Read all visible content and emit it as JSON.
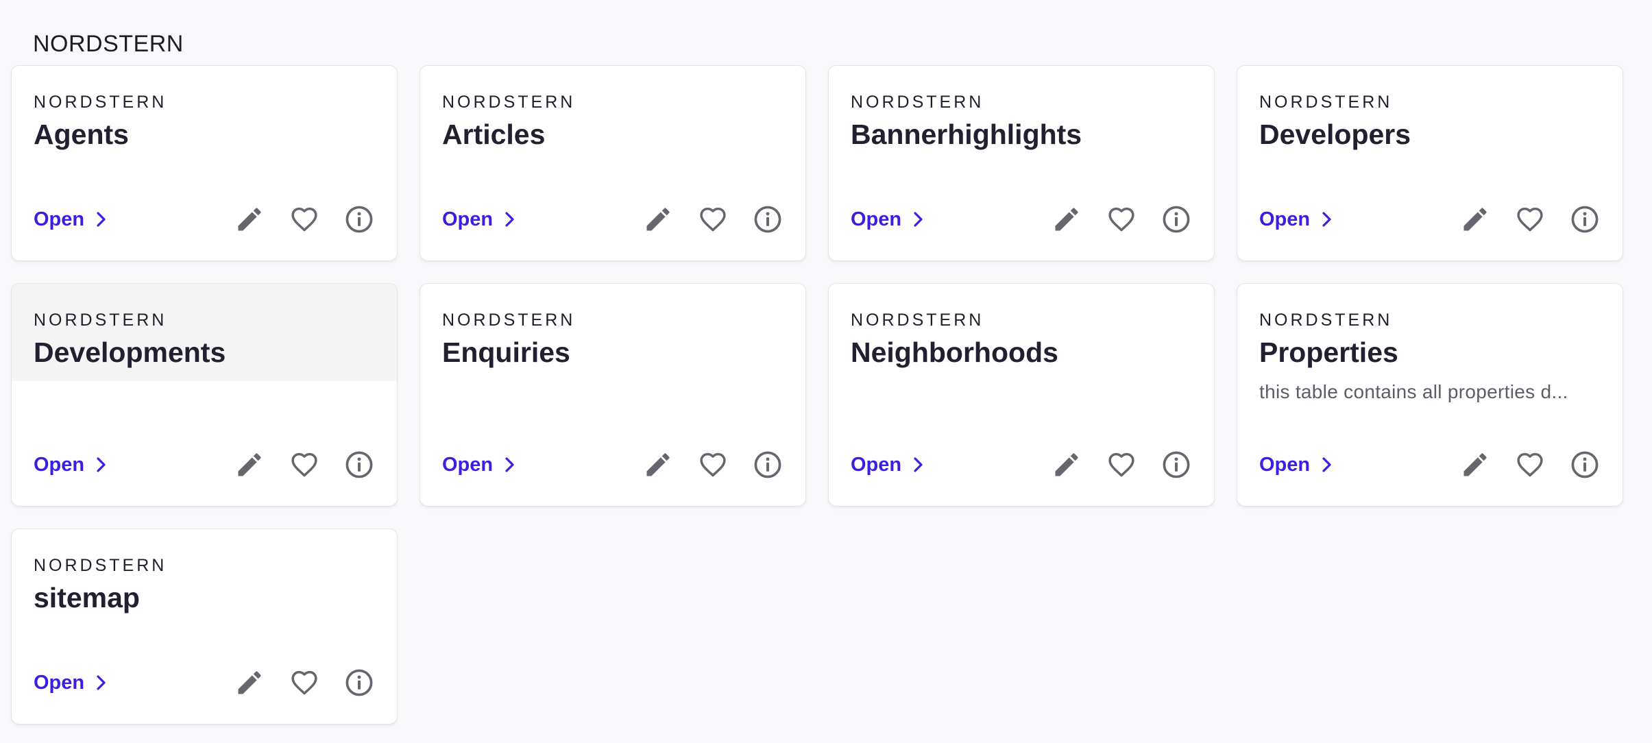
{
  "header": {
    "title": "NORDSTERN"
  },
  "cards": [
    {
      "overline": "NORDSTERN",
      "title": "Agents",
      "description": "",
      "open_label": "Open",
      "icons": [
        "pencil-icon",
        "heart-icon",
        "info-icon"
      ]
    },
    {
      "overline": "NORDSTERN",
      "title": "Articles",
      "description": "",
      "open_label": "Open",
      "icons": [
        "pencil-icon",
        "heart-icon",
        "info-icon"
      ]
    },
    {
      "overline": "NORDSTERN",
      "title": "Bannerhighlights",
      "description": "",
      "open_label": "Open",
      "icons": [
        "pencil-icon",
        "heart-icon",
        "info-icon"
      ]
    },
    {
      "overline": "NORDSTERN",
      "title": "Developers",
      "description": "",
      "open_label": "Open",
      "icons": [
        "pencil-icon",
        "heart-icon",
        "info-icon"
      ]
    },
    {
      "overline": "NORDSTERN",
      "title": "Developments",
      "description": "",
      "open_label": "Open",
      "icons": [
        "pencil-icon",
        "heart-icon",
        "info-icon"
      ]
    },
    {
      "overline": "NORDSTERN",
      "title": "Enquiries",
      "description": "",
      "open_label": "Open",
      "icons": [
        "pencil-icon",
        "heart-icon",
        "info-icon"
      ]
    },
    {
      "overline": "NORDSTERN",
      "title": "Neighborhoods",
      "description": "",
      "open_label": "Open",
      "icons": [
        "pencil-icon",
        "heart-icon",
        "info-icon"
      ]
    },
    {
      "overline": "NORDSTERN",
      "title": "Properties",
      "description": "this table contains all properties d...",
      "open_label": "Open",
      "icons": [
        "pencil-icon",
        "heart-icon",
        "info-icon"
      ]
    },
    {
      "overline": "NORDSTERN",
      "title": "sitemap",
      "description": "",
      "open_label": "Open",
      "icons": [
        "pencil-icon",
        "heart-icon",
        "info-icon"
      ]
    }
  ],
  "colors": {
    "accent": "#3a1fe0",
    "icon": "#66666e",
    "background": "#f9f9fb",
    "card": "#ffffff",
    "hover_head": "#f5f5f6"
  }
}
